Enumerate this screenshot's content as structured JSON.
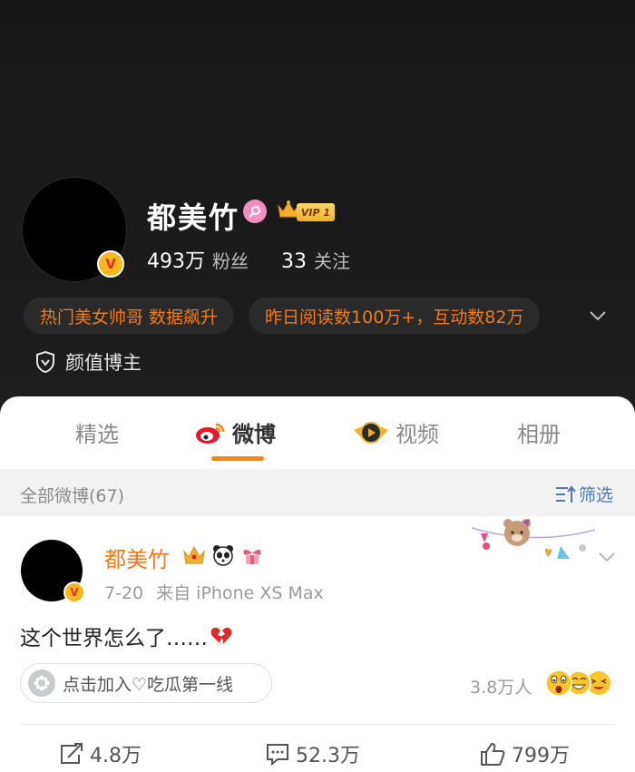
{
  "profile": {
    "name": "都美竹",
    "vip_label": "VIP 1",
    "verified_mark": "V",
    "followers": {
      "value": "493万",
      "label": "粉丝"
    },
    "following": {
      "value": "33",
      "label": "关注"
    },
    "tags": [
      "热门美女帅哥 数据飙升",
      "昨日阅读数100万+，互动数82万"
    ],
    "blogger_type": "颜值博主"
  },
  "tabs": [
    {
      "label": "精选",
      "active": false
    },
    {
      "label": "微博",
      "active": true,
      "icon": "weibo-icon"
    },
    {
      "label": "视频",
      "active": false,
      "icon": "video-icon"
    },
    {
      "label": "相册",
      "active": false
    }
  ],
  "filter": {
    "count_label": "全部微博(67)",
    "filter_label": "筛选"
  },
  "post": {
    "author": "都美竹",
    "verified_mark": "V",
    "date": "7-20",
    "source": "来自 iPhone XS Max",
    "text": "这个世界怎么了……",
    "text_emoji": "broken-heart-icon",
    "topic": "点击加入♡吃瓜第一线",
    "reaction_count": "3.8万人",
    "actions": {
      "reposts": "4.8万",
      "comments": "52.3万",
      "likes": "799万"
    }
  },
  "colors": {
    "header_bg": "#1a1a1a",
    "accent_orange": "#f07a1e",
    "tab_underline": "#f6840f",
    "filter_blue": "#4f79b7"
  }
}
